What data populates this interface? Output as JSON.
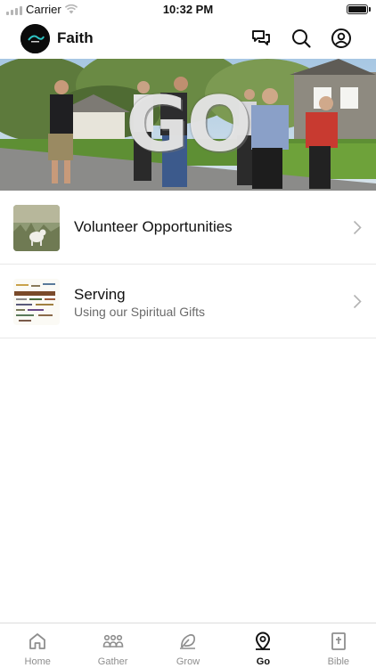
{
  "status_bar": {
    "carrier": "Carrier",
    "time": "10:32 PM"
  },
  "header": {
    "title": "Faith",
    "icons": [
      "chat-icon",
      "search-icon",
      "profile-icon"
    ]
  },
  "hero": {
    "text": "GO"
  },
  "items": [
    {
      "title": "Volunteer Opportunities",
      "subtitle": ""
    },
    {
      "title": "Serving",
      "subtitle": "Using our Spiritual Gifts"
    }
  ],
  "tabs": [
    {
      "label": "Home",
      "icon": "home-icon",
      "active": false
    },
    {
      "label": "Gather",
      "icon": "gather-icon",
      "active": false
    },
    {
      "label": "Grow",
      "icon": "grow-icon",
      "active": false
    },
    {
      "label": "Go",
      "icon": "location-pin-icon",
      "active": true
    },
    {
      "label": "Bible",
      "icon": "bible-icon",
      "active": false
    }
  ],
  "colors": {
    "active_tab": "#111111",
    "inactive_tab": "#8e8e8e",
    "divider": "#e8e8e8"
  }
}
